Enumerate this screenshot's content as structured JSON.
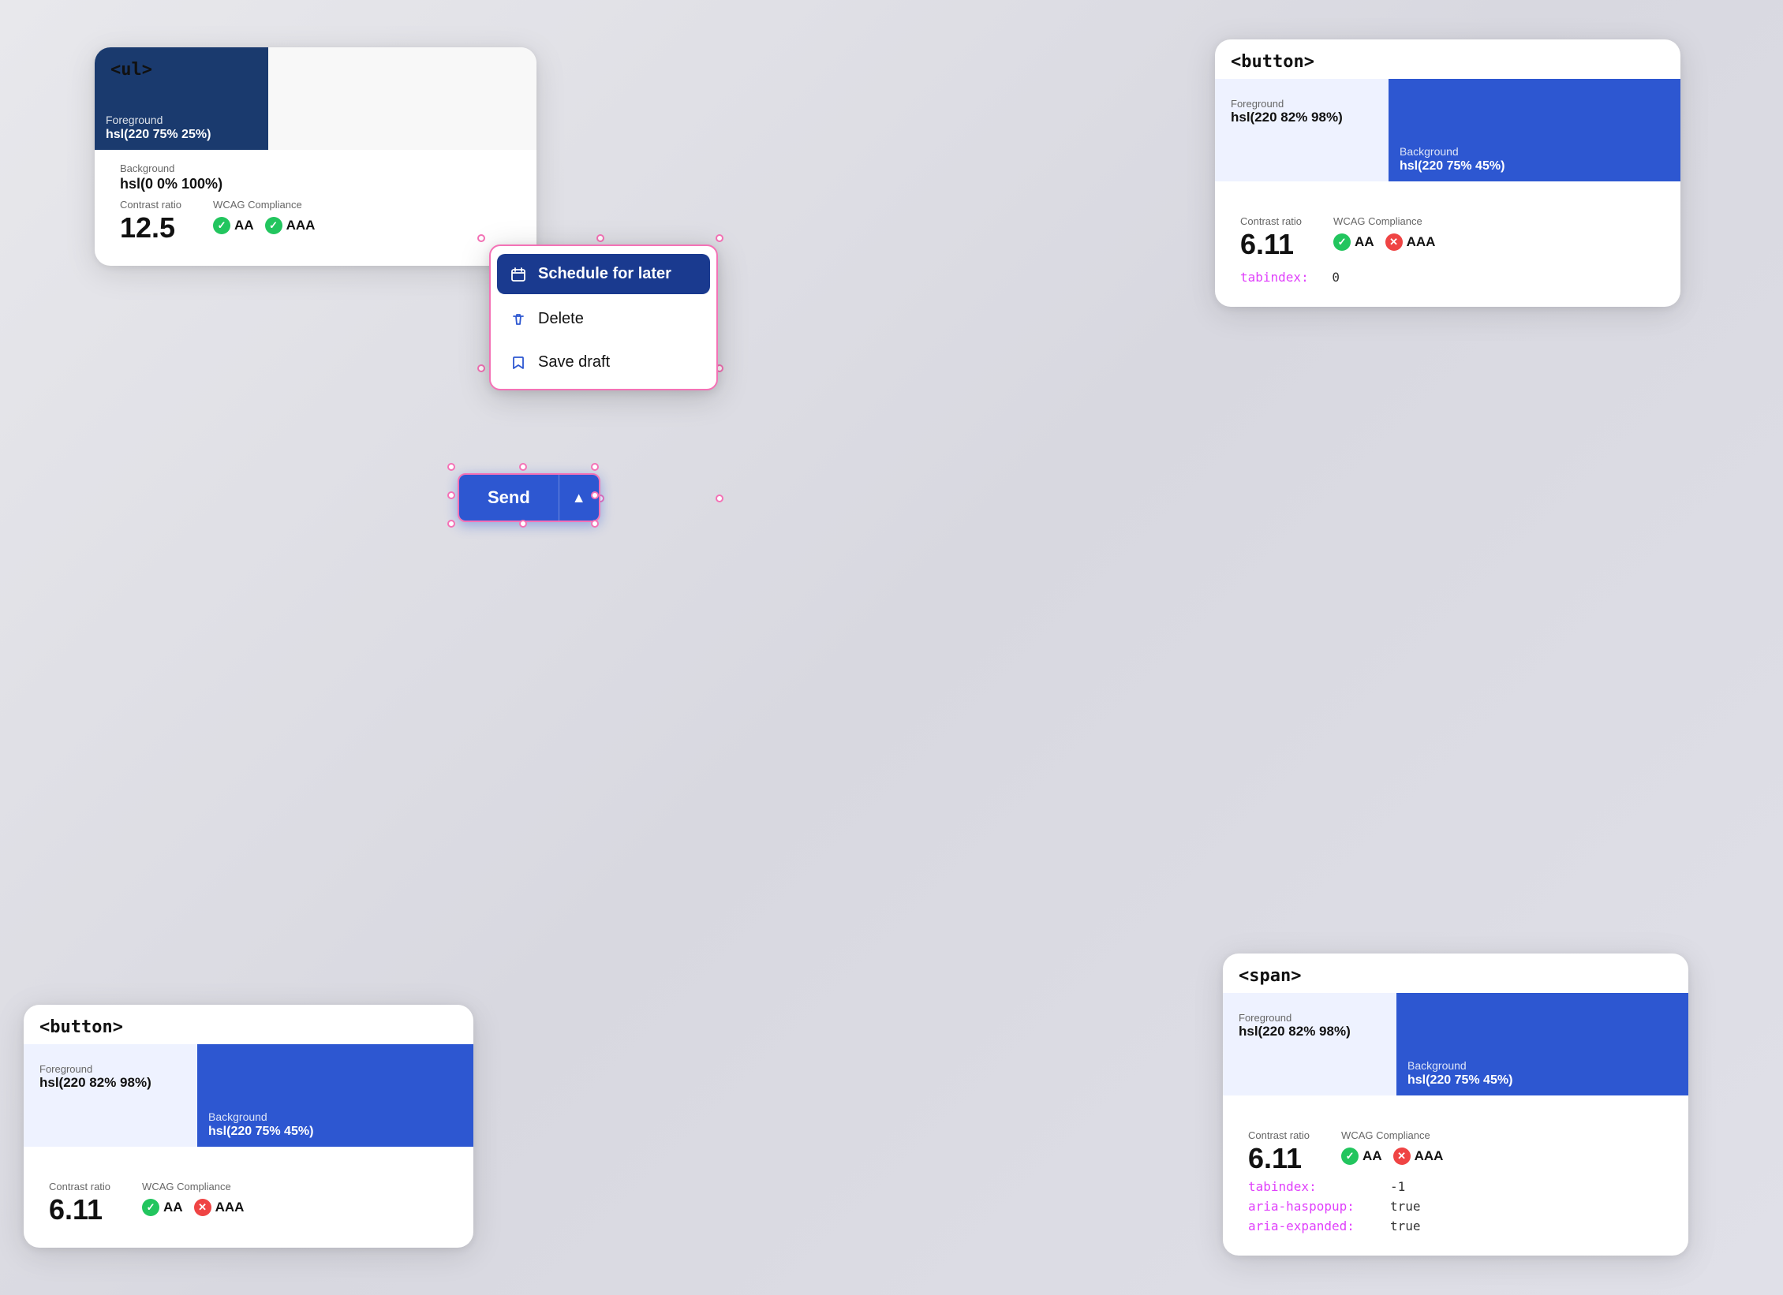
{
  "cards": {
    "ul": {
      "tag": "<ul>",
      "fg_label": "Foreground",
      "fg_value": "hsl(220 75% 25%)",
      "bg_label": "Background",
      "bg_value": "hsl(0 0% 100%)",
      "contrast_label": "Contrast ratio",
      "contrast_value": "12.5",
      "wcag_label": "WCAG Compliance",
      "aa_label": "AA",
      "aaa_label": "AAA"
    },
    "button_top": {
      "tag": "<button>",
      "fg_label": "Foreground",
      "fg_value": "hsl(220 82% 98%)",
      "bg_label": "Background",
      "bg_value": "hsl(220 75% 45%)",
      "contrast_label": "Contrast ratio",
      "contrast_value": "6.11",
      "wcag_label": "WCAG Compliance",
      "aa_label": "AA",
      "aaa_label": "AAA",
      "tabindex_label": "tabindex:",
      "tabindex_value": "0"
    },
    "button_bot": {
      "tag": "<button>",
      "fg_label": "Foreground",
      "fg_value": "hsl(220 82% 98%)",
      "bg_label": "Background",
      "bg_value": "hsl(220 75% 45%)",
      "contrast_label": "Contrast ratio",
      "contrast_value": "6.11",
      "wcag_label": "WCAG Compliance",
      "aa_label": "AA",
      "aaa_label": "AAA"
    },
    "span": {
      "tag": "<span>",
      "fg_label": "Foreground",
      "fg_value": "hsl(220 82% 98%)",
      "bg_label": "Background",
      "bg_value": "hsl(220 75% 45%)",
      "contrast_label": "Contrast ratio",
      "contrast_value": "6.11",
      "wcag_label": "WCAG Compliance",
      "aa_label": "AA",
      "aaa_label": "AAA",
      "tabindex_label": "tabindex:",
      "tabindex_value": "-1",
      "aria_haspopup_label": "aria-haspopup:",
      "aria_haspopup_value": "true",
      "aria_expanded_label": "aria-expanded:",
      "aria_expanded_value": "true"
    }
  },
  "dropdown": {
    "items": [
      {
        "label": "Schedule for later",
        "icon": "calendar"
      },
      {
        "label": "Delete",
        "icon": "trash"
      },
      {
        "label": "Save draft",
        "icon": "bookmark"
      }
    ]
  },
  "send_button": {
    "label": "Send",
    "arrow": "▲"
  }
}
